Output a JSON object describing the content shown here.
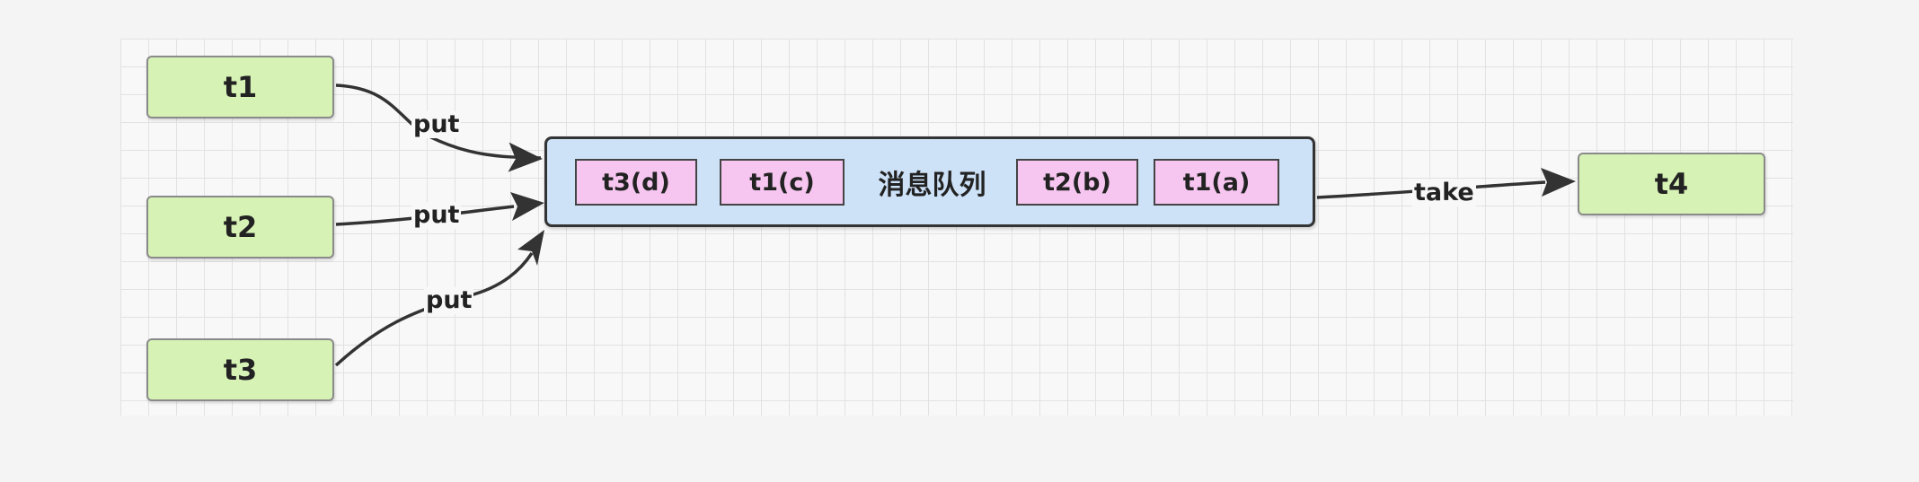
{
  "nodes": {
    "t1": "t1",
    "t2": "t2",
    "t3": "t3",
    "t4": "t4"
  },
  "queue": {
    "label": "消息队列",
    "messages": [
      "t3(d)",
      "t1(c)",
      "t2(b)",
      "t1(a)"
    ]
  },
  "edges": {
    "put_1": "put",
    "put_2": "put",
    "put_3": "put",
    "take": "take"
  },
  "colors": {
    "producer_fill": "#d7f2b5",
    "queue_fill": "#cde1f7",
    "message_fill": "#f6c6f0"
  }
}
